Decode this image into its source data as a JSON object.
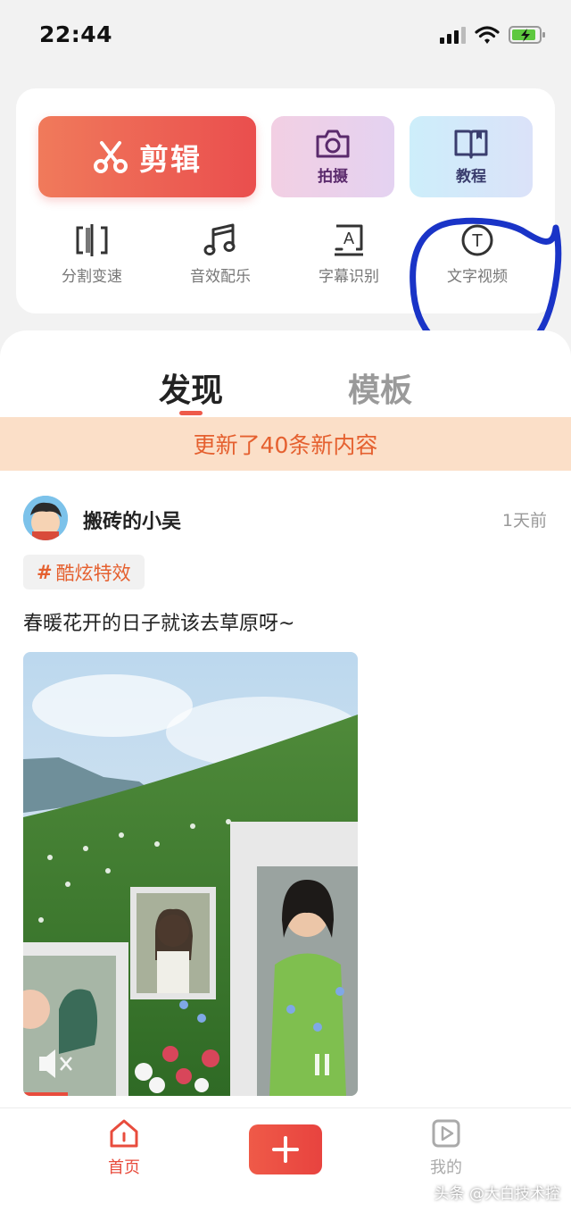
{
  "status_bar": {
    "time": "22:44"
  },
  "tools": {
    "edit_label": "剪辑",
    "shoot_label": "拍摄",
    "tutorial_label": "教程",
    "mini": [
      {
        "label": "分割变速",
        "icon": "split-speed-icon"
      },
      {
        "label": "音效配乐",
        "icon": "music-note-icon"
      },
      {
        "label": "字幕识别",
        "icon": "subtitle-recognize-icon"
      },
      {
        "label": "文字视频",
        "icon": "text-video-icon"
      }
    ]
  },
  "tabs": {
    "discover": "发现",
    "template": "模板"
  },
  "update_banner": "更新了40条新内容",
  "post": {
    "author": "搬砖的小吴",
    "time": "1天前",
    "tag_hash": "#",
    "tag": "酷炫特效",
    "text": "春暖花开的日子就该去草原呀~"
  },
  "bottom_nav": {
    "home": "首页",
    "mine": "我的"
  },
  "watermark": "头条 @大白技术控",
  "colors": {
    "accent": "#e84c3d",
    "banner_bg": "#fbdfc8",
    "banner_text": "#e5602f",
    "annotation": "#1a34c7"
  }
}
